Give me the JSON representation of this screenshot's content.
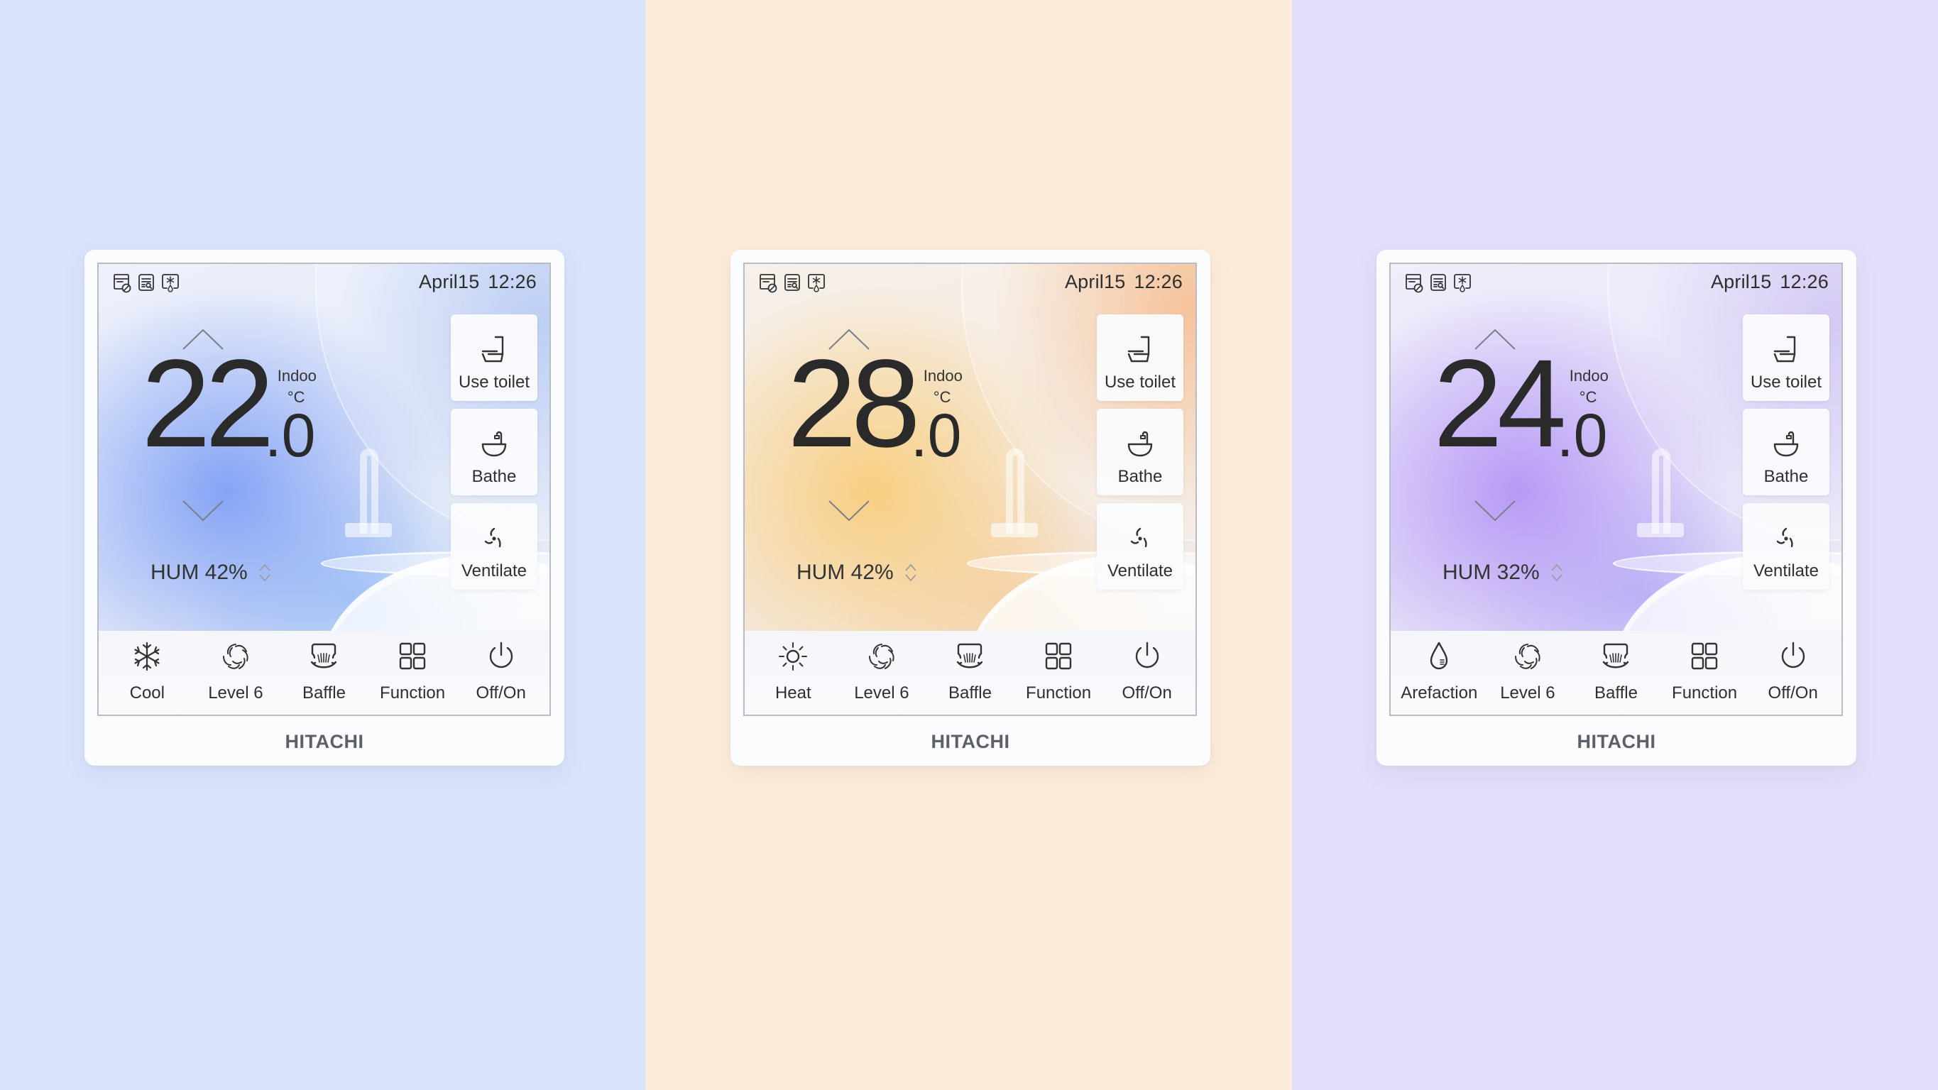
{
  "backgrounds": [
    "#d9e3fc",
    "#fdecd9",
    "#e4defc"
  ],
  "panels": [
    {
      "theme": "cool-blue",
      "accent": "#80a0f5",
      "status_icons": [
        "filter-blocked-icon",
        "log-search-icon",
        "frost-drip-icon"
      ],
      "date": "April15",
      "time": "12:26",
      "temperature": {
        "integer": "22",
        "decimal": ".0",
        "label": "Indoo",
        "unit": "°C"
      },
      "humidity": {
        "label": "HUM",
        "value": "42%"
      },
      "side_buttons": [
        {
          "label": "Use toilet",
          "icon": "toilet-icon"
        },
        {
          "label": "Bathe",
          "icon": "bathtub-icon"
        },
        {
          "label": "Ventilate",
          "icon": "ventilate-icon"
        }
      ],
      "bottom_bar": [
        {
          "label": "Cool",
          "icon": "snowflake-icon"
        },
        {
          "label": "Level 6",
          "icon": "fan-swirl-icon"
        },
        {
          "label": "Baffle",
          "icon": "baffle-icon"
        },
        {
          "label": "Function",
          "icon": "grid-icon"
        },
        {
          "label": "Off/On",
          "icon": "power-icon"
        }
      ],
      "brand": "HITACHI"
    },
    {
      "theme": "warm-orange",
      "accent": "#f8cd7d",
      "status_icons": [
        "filter-blocked-icon",
        "log-search-icon",
        "frost-drip-icon"
      ],
      "date": "April15",
      "time": "12:26",
      "temperature": {
        "integer": "28",
        "decimal": ".0",
        "label": "Indoo",
        "unit": "°C"
      },
      "humidity": {
        "label": "HUM",
        "value": "42%"
      },
      "side_buttons": [
        {
          "label": "Use toilet",
          "icon": "toilet-icon"
        },
        {
          "label": "Bathe",
          "icon": "bathtub-icon"
        },
        {
          "label": "Ventilate",
          "icon": "ventilate-icon"
        }
      ],
      "bottom_bar": [
        {
          "label": "Heat",
          "icon": "sun-icon"
        },
        {
          "label": "Level 6",
          "icon": "fan-swirl-icon"
        },
        {
          "label": "Baffle",
          "icon": "baffle-icon"
        },
        {
          "label": "Function",
          "icon": "grid-icon"
        },
        {
          "label": "Off/On",
          "icon": "power-icon"
        }
      ],
      "brand": "HITACHI"
    },
    {
      "theme": "violet",
      "accent": "#b496f5",
      "status_icons": [
        "filter-blocked-icon",
        "log-search-icon",
        "frost-drip-icon"
      ],
      "date": "April15",
      "time": "12:26",
      "temperature": {
        "integer": "24",
        "decimal": ".0",
        "label": "Indoo",
        "unit": "°C"
      },
      "humidity": {
        "label": "HUM",
        "value": "32%"
      },
      "side_buttons": [
        {
          "label": "Use toilet",
          "icon": "toilet-icon"
        },
        {
          "label": "Bathe",
          "icon": "bathtub-icon"
        },
        {
          "label": "Ventilate",
          "icon": "ventilate-icon"
        }
      ],
      "bottom_bar": [
        {
          "label": "Arefaction",
          "icon": "water-drop-icon"
        },
        {
          "label": "Level 6",
          "icon": "fan-swirl-icon"
        },
        {
          "label": "Baffle",
          "icon": "baffle-icon"
        },
        {
          "label": "Function",
          "icon": "grid-icon"
        },
        {
          "label": "Off/On",
          "icon": "power-icon"
        }
      ],
      "brand": "HITACHI"
    }
  ]
}
